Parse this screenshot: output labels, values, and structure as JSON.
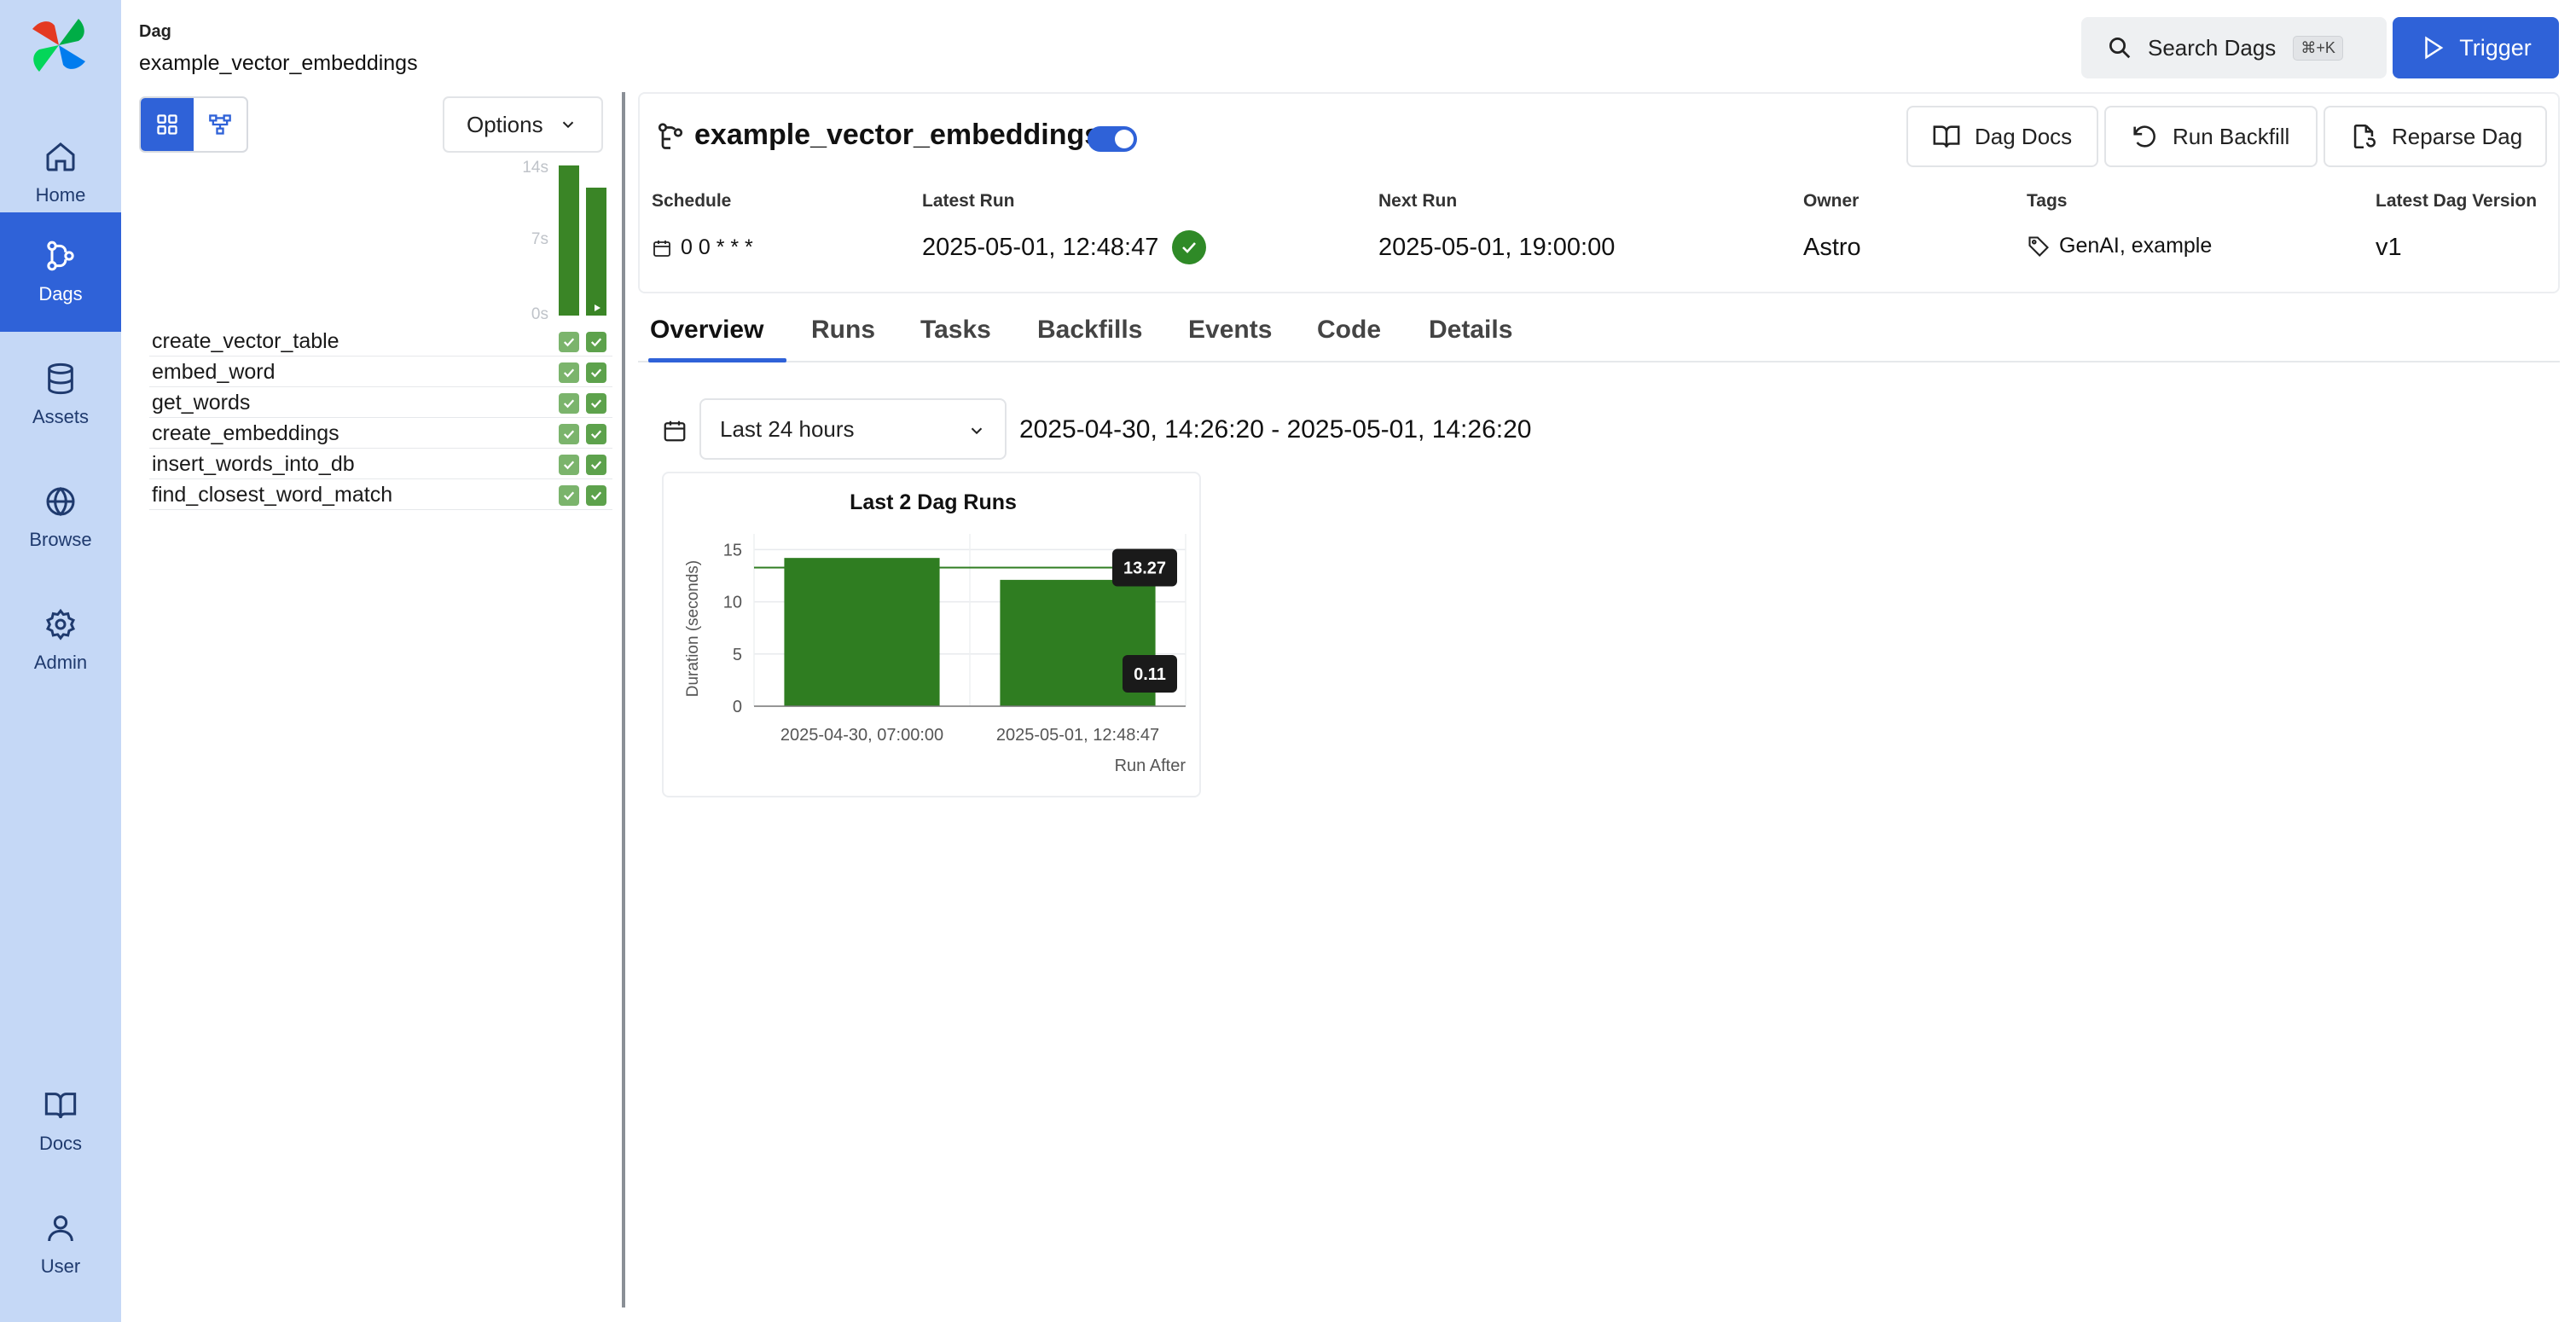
{
  "header": {
    "label": "Dag",
    "dag_id": "example_vector_embeddings",
    "search_label": "Search Dags",
    "search_shortcut": "⌘+K",
    "trigger_label": "Trigger"
  },
  "nav": {
    "items": [
      {
        "label": "Home",
        "icon": "home-icon"
      },
      {
        "label": "Dags",
        "icon": "dags-icon",
        "active": true
      },
      {
        "label": "Assets",
        "icon": "database-icon"
      },
      {
        "label": "Browse",
        "icon": "globe-icon"
      },
      {
        "label": "Admin",
        "icon": "gear-icon"
      },
      {
        "label": "Docs",
        "icon": "book-icon"
      },
      {
        "label": "User",
        "icon": "user-icon"
      }
    ]
  },
  "grid": {
    "options_label": "Options",
    "duration_ticks": [
      "14s",
      "7s",
      "0s"
    ],
    "runs": [
      {
        "duration_s": 14.2
      },
      {
        "duration_s": 12.1
      }
    ],
    "tasks": [
      {
        "name": "create_vector_table",
        "states": [
          "success",
          "success"
        ]
      },
      {
        "name": "embed_word",
        "states": [
          "success",
          "success"
        ]
      },
      {
        "name": "get_words",
        "states": [
          "success",
          "success"
        ]
      },
      {
        "name": "create_embeddings",
        "states": [
          "success",
          "success"
        ]
      },
      {
        "name": "insert_words_into_db",
        "states": [
          "success",
          "success"
        ]
      },
      {
        "name": "find_closest_word_match",
        "states": [
          "success",
          "success"
        ]
      }
    ]
  },
  "dag": {
    "name": "example_vector_embeddings",
    "actions": {
      "docs": "Dag Docs",
      "backfill": "Run Backfill",
      "reparse": "Reparse Dag"
    },
    "meta": {
      "schedule_label": "Schedule",
      "schedule": "0 0 * * *",
      "latest_run_label": "Latest Run",
      "latest_run": "2025-05-01, 12:48:47",
      "next_run_label": "Next Run",
      "next_run": "2025-05-01, 19:00:00",
      "owner_label": "Owner",
      "owner": "Astro",
      "tags_label": "Tags",
      "tags": "GenAI, example",
      "version_label": "Latest Dag Version",
      "version": "v1"
    }
  },
  "tabs": [
    "Overview",
    "Runs",
    "Tasks",
    "Backfills",
    "Events",
    "Code",
    "Details"
  ],
  "filter": {
    "range_option": "Last 24 hours",
    "range_text": "2025-04-30, 14:26:20 - 2025-05-01, 14:26:20"
  },
  "colors": {
    "accent": "#2f62d8",
    "success": "#3a8526",
    "nav_bg": "#c5d8f6"
  },
  "chart_data": {
    "type": "bar",
    "title": "Last 2 Dag Runs",
    "xlabel": "Run After",
    "ylabel": "Duration (seconds)",
    "categories": [
      "2025-04-30, 07:00:00",
      "2025-05-01, 12:48:47"
    ],
    "values": [
      14.2,
      12.1
    ],
    "ylim": [
      0,
      16.5
    ],
    "yticks": [
      0,
      5,
      10,
      15
    ],
    "reference_line": {
      "value": 13.27,
      "label": "13.27"
    },
    "annotation": {
      "value": 0.11,
      "label": "0.11"
    },
    "grid": true
  }
}
